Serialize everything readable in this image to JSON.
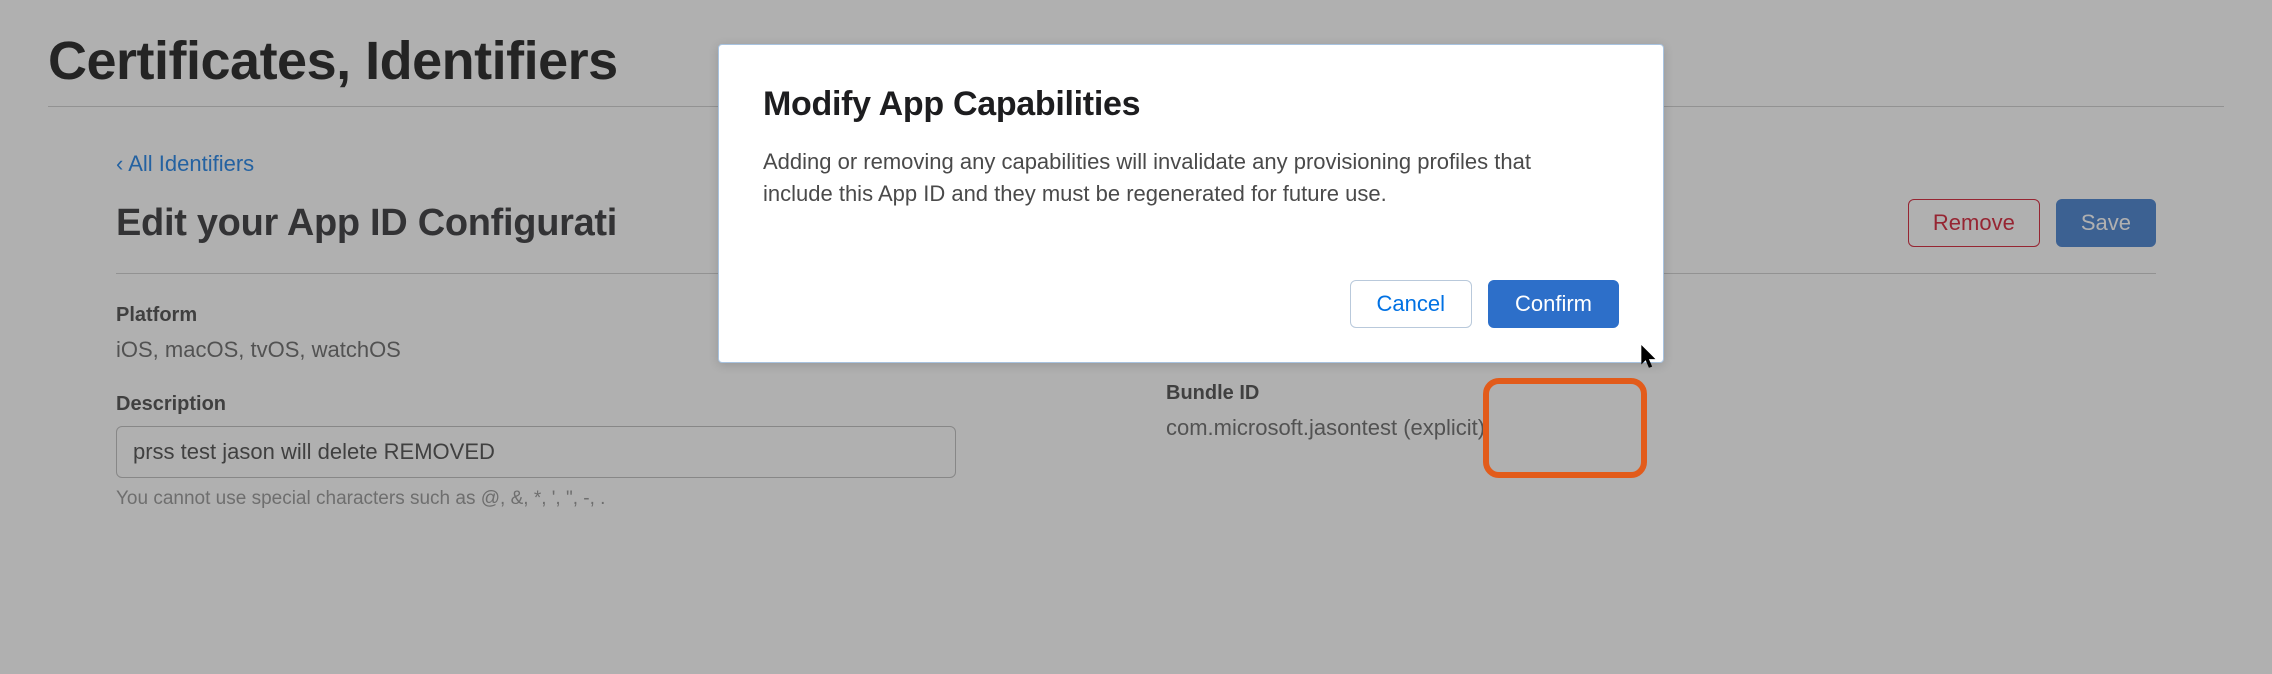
{
  "page": {
    "title": "Certificates, Identifiers"
  },
  "nav": {
    "back_link": "‹ All Identifiers"
  },
  "subheader": {
    "title": "Edit your App ID Configurati"
  },
  "actions": {
    "remove_label": "Remove",
    "save_label": "Save"
  },
  "form": {
    "platform_label": "Platform",
    "platform_value": "iOS, macOS, tvOS, watchOS",
    "description_label": "Description",
    "description_value": "prss test jason will delete REMOVED",
    "description_hint": "You cannot use special characters such as @, &, *, ', \", -, .",
    "bundle_id_label": "Bundle ID",
    "bundle_id_value": "com.microsoft.jasontest (explicit)"
  },
  "modal": {
    "title": "Modify App Capabilities",
    "body": "Adding or removing any capabilities will invalidate any provisioning profiles that include this App ID and they must be regenerated for future use.",
    "cancel_label": "Cancel",
    "confirm_label": "Confirm"
  }
}
